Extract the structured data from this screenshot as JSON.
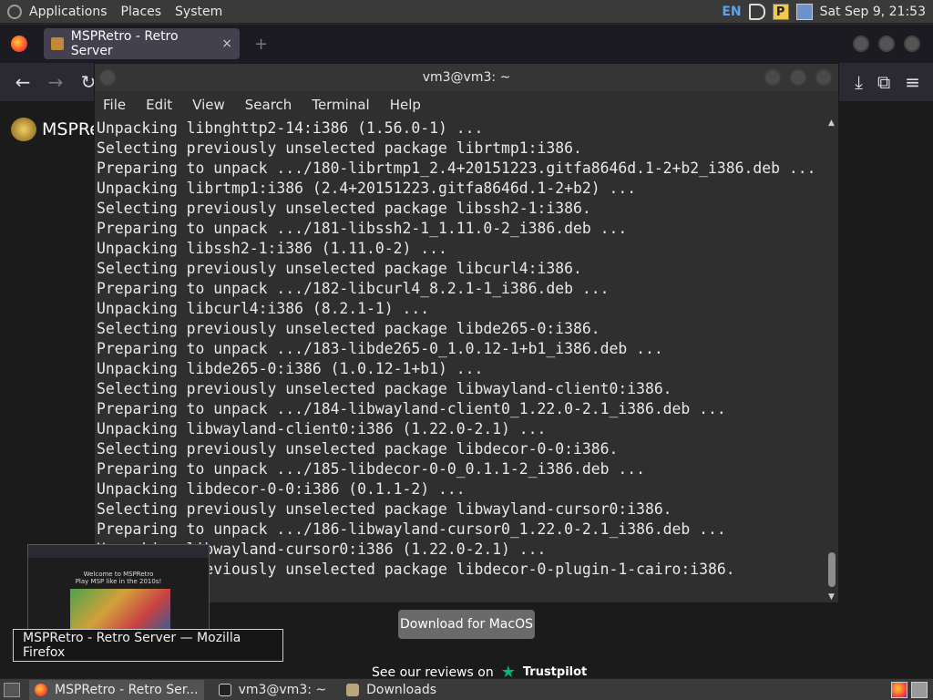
{
  "top_panel": {
    "menus": [
      "Applications",
      "Places",
      "System"
    ],
    "lang": "EN",
    "p_label": "P",
    "clock": "Sat Sep 9, 21:53"
  },
  "firefox": {
    "tab_title": "MSPRetro - Retro Server",
    "close_symbol": "×",
    "new_tab_symbol": "+",
    "site_title": "MSPRe",
    "download_label": "Download for MacOS",
    "reviews_text": "See our reviews on",
    "trustpilot_label": "Trustpilot"
  },
  "terminal": {
    "title": "vm3@vm3: ~",
    "menu": [
      "File",
      "Edit",
      "View",
      "Search",
      "Terminal",
      "Help"
    ],
    "lines": [
      "Unpacking libnghttp2-14:i386 (1.56.0-1) ...",
      "Selecting previously unselected package librtmp1:i386.",
      "Preparing to unpack .../180-librtmp1_2.4+20151223.gitfa8646d.1-2+b2_i386.deb ...",
      "Unpacking librtmp1:i386 (2.4+20151223.gitfa8646d.1-2+b2) ...",
      "Selecting previously unselected package libssh2-1:i386.",
      "Preparing to unpack .../181-libssh2-1_1.11.0-2_i386.deb ...",
      "Unpacking libssh2-1:i386 (1.11.0-2) ...",
      "Selecting previously unselected package libcurl4:i386.",
      "Preparing to unpack .../182-libcurl4_8.2.1-1_i386.deb ...",
      "Unpacking libcurl4:i386 (8.2.1-1) ...",
      "Selecting previously unselected package libde265-0:i386.",
      "Preparing to unpack .../183-libde265-0_1.0.12-1+b1_i386.deb ...",
      "Unpacking libde265-0:i386 (1.0.12-1+b1) ...",
      "Selecting previously unselected package libwayland-client0:i386.",
      "Preparing to unpack .../184-libwayland-client0_1.22.0-2.1_i386.deb ...",
      "Unpacking libwayland-client0:i386 (1.22.0-2.1) ...",
      "Selecting previously unselected package libdecor-0-0:i386.",
      "Preparing to unpack .../185-libdecor-0-0_0.1.1-2_i386.deb ...",
      "Unpacking libdecor-0-0:i386 (0.1.1-2) ...",
      "Selecting previously unselected package libwayland-cursor0:i386.",
      "Preparing to unpack .../186-libwayland-cursor0_1.22.0-2.1_i386.deb ...",
      "Unpacking libwayland-cursor0:i386 (1.22.0-2.1) ...",
      "Selecting previously unselected package libdecor-0-plugin-1-cairo:i386."
    ]
  },
  "preview": {
    "heading": "Welcome to MSPRetro",
    "subheading": "Play MSP like in the 2010s!"
  },
  "tooltip": "MSPRetro - Retro Server — Mozilla Firefox",
  "taskbar": {
    "tasks": [
      "MSPRetro - Retro Ser...",
      "vm3@vm3: ~",
      "Downloads"
    ]
  },
  "colors": {
    "panel": "#3a3a3a",
    "terminal_bg": "#2f2f2f",
    "accent_lang": "#5aa4f0",
    "trustpilot": "#00b67a"
  }
}
